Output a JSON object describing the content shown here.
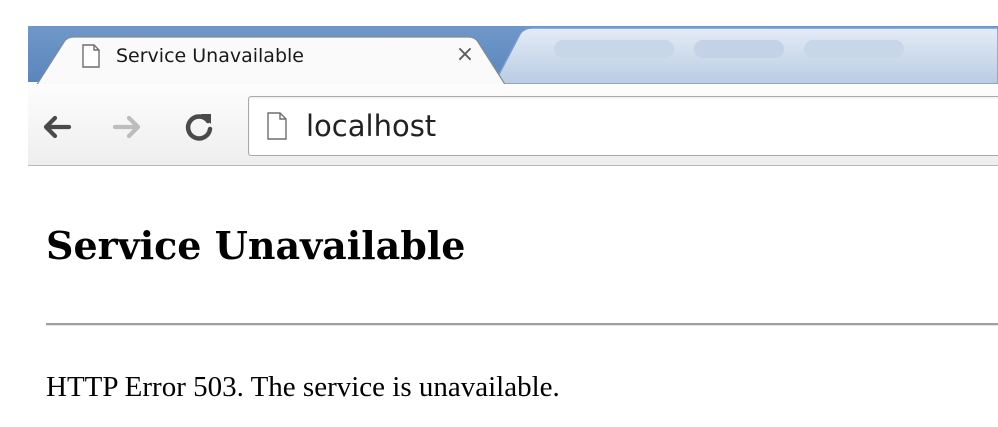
{
  "browser": {
    "tab": {
      "title": "Service Unavailable",
      "close_glyph": "×",
      "favicon": "page-icon"
    },
    "toolbar": {
      "back_icon": "arrow-left-icon",
      "forward_icon": "arrow-right-icon",
      "reload_icon": "reload-icon"
    },
    "omnibox": {
      "url": "localhost",
      "page_icon": "page-icon"
    }
  },
  "page": {
    "heading": "Service Unavailable",
    "message": "HTTP Error 503. The service is unavailable."
  },
  "colors": {
    "tabstrip": "#5b86bd",
    "text": "#000000"
  }
}
